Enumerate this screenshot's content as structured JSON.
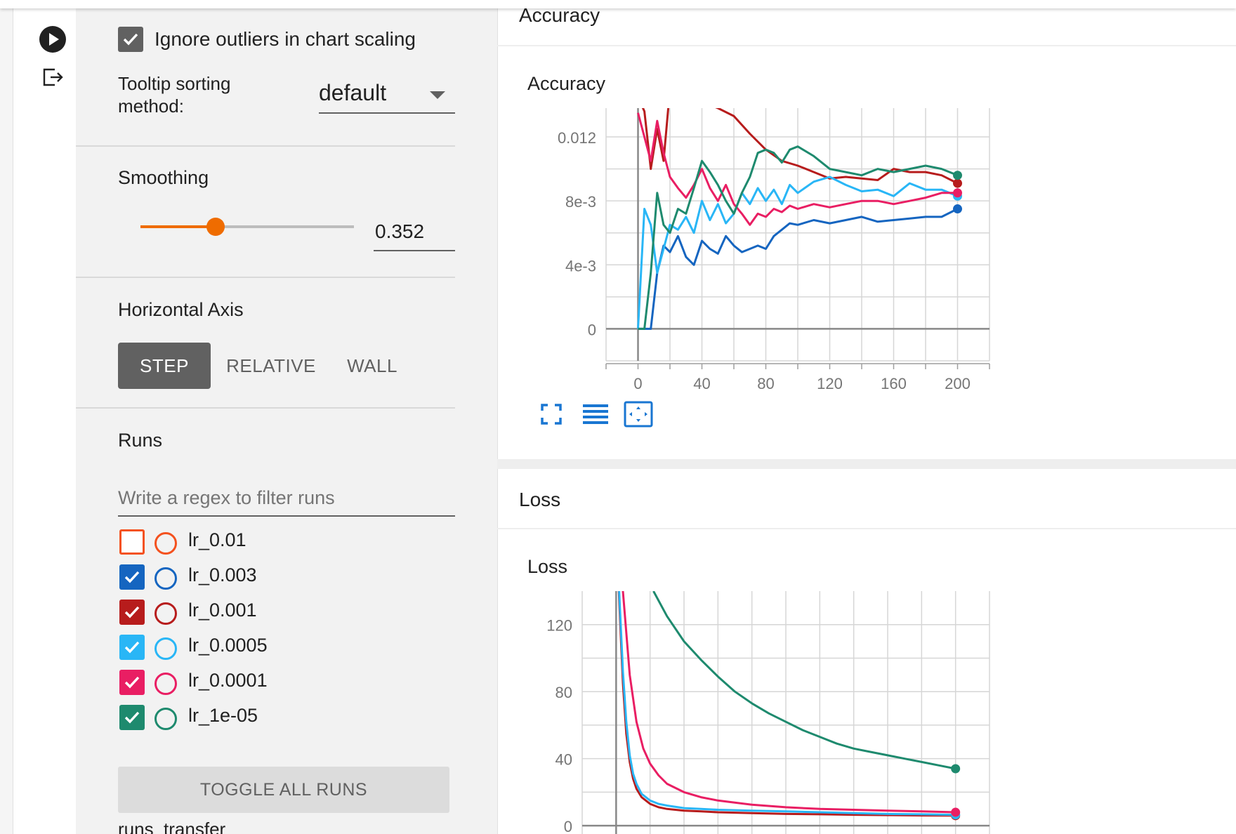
{
  "sidebar": {
    "ignore_outliers": {
      "label": "Ignore outliers in chart scaling",
      "checked": true
    },
    "tooltip_sort": {
      "label_line1": "Tooltip sorting",
      "label_line2": "method:",
      "value": "default"
    },
    "smoothing": {
      "label": "Smoothing",
      "value": "0.352",
      "fraction": 0.352
    },
    "horizontal_axis": {
      "label": "Horizontal Axis",
      "options": [
        "STEP",
        "RELATIVE",
        "WALL"
      ],
      "selected": "STEP"
    },
    "runs": {
      "label": "Runs",
      "filter_placeholder": "Write a regex to filter runs",
      "items": [
        {
          "name": "lr_0.01",
          "color": "#f4511e",
          "checked": false
        },
        {
          "name": "lr_0.003",
          "color": "#1565c0",
          "checked": true
        },
        {
          "name": "lr_0.001",
          "color": "#b71c1c",
          "checked": true
        },
        {
          "name": "lr_0.0005",
          "color": "#29b6f6",
          "checked": true
        },
        {
          "name": "lr_0.0001",
          "color": "#e91e63",
          "checked": true
        },
        {
          "name": "lr_1e-05",
          "color": "#1e8a6e",
          "checked": true
        }
      ],
      "toggle_all_label": "TOGGLE ALL RUNS",
      "footer": "runs_transfer"
    }
  },
  "rail": {
    "icons": [
      "play-icon",
      "logout-icon"
    ]
  },
  "main": {
    "accuracy_category": "Accuracy",
    "loss_category": "Loss"
  },
  "chart_data": [
    {
      "type": "line",
      "title": "Accuracy",
      "xlabel": "",
      "ylabel": "",
      "x_ticks": [
        "0",
        "40",
        "80",
        "120",
        "160",
        "200"
      ],
      "y_ticks": [
        "0",
        "4e-3",
        "8e-3",
        "0.012"
      ],
      "xlim": [
        -20,
        220
      ],
      "ylim": [
        -0.002,
        0.0138
      ],
      "grid": true,
      "series": [
        {
          "name": "lr_0.003",
          "color": "#1565c0",
          "x": [
            0,
            4,
            8,
            12,
            16,
            20,
            25,
            30,
            35,
            40,
            45,
            50,
            55,
            60,
            65,
            70,
            75,
            80,
            85,
            90,
            95,
            100,
            110,
            120,
            130,
            140,
            150,
            160,
            170,
            180,
            190,
            200
          ],
          "y": [
            0,
            0,
            0,
            0.0035,
            0.0052,
            0.0048,
            0.0058,
            0.0045,
            0.004,
            0.0055,
            0.005,
            0.0047,
            0.0058,
            0.0052,
            0.0048,
            0.005,
            0.0052,
            0.005,
            0.0058,
            0.0062,
            0.0066,
            0.0065,
            0.0068,
            0.0066,
            0.0068,
            0.007,
            0.0067,
            0.0068,
            0.0069,
            0.007,
            0.007,
            0.0075
          ]
        },
        {
          "name": "lr_0.001",
          "color": "#b71c1c",
          "x": [
            0,
            4,
            8,
            12,
            16,
            20,
            30,
            40,
            50,
            60,
            70,
            80,
            90,
            100,
            110,
            120,
            130,
            140,
            150,
            160,
            170,
            180,
            190,
            200
          ],
          "y": [
            0.0145,
            0.0136,
            0.01,
            0.0125,
            0.0105,
            0.015,
            0.0155,
            0.0142,
            0.0138,
            0.0133,
            0.0122,
            0.0112,
            0.0105,
            0.0102,
            0.0098,
            0.0094,
            0.0095,
            0.0094,
            0.0093,
            0.01,
            0.0098,
            0.0098,
            0.0096,
            0.0091
          ]
        },
        {
          "name": "lr_0.0005",
          "color": "#29b6f6",
          "x": [
            0,
            4,
            8,
            12,
            16,
            20,
            25,
            30,
            35,
            40,
            45,
            50,
            55,
            60,
            65,
            70,
            75,
            80,
            85,
            90,
            95,
            100,
            110,
            120,
            130,
            140,
            150,
            160,
            170,
            180,
            190,
            200
          ],
          "y": [
            0,
            0.0075,
            0.0065,
            0.0035,
            0.005,
            0.0065,
            0.0062,
            0.007,
            0.006,
            0.008,
            0.0068,
            0.0078,
            0.0066,
            0.0072,
            0.0085,
            0.0078,
            0.0088,
            0.008,
            0.0087,
            0.0078,
            0.009,
            0.0085,
            0.0092,
            0.0095,
            0.009,
            0.0086,
            0.0087,
            0.0083,
            0.0091,
            0.0087,
            0.0087,
            0.0083
          ]
        },
        {
          "name": "lr_0.0001",
          "color": "#e91e63",
          "x": [
            0,
            4,
            8,
            12,
            16,
            20,
            25,
            30,
            35,
            40,
            45,
            50,
            55,
            60,
            65,
            70,
            75,
            80,
            85,
            90,
            95,
            100,
            110,
            120,
            130,
            140,
            150,
            160,
            170,
            180,
            190,
            200
          ],
          "y": [
            0.0135,
            0.012,
            0.0105,
            0.013,
            0.011,
            0.0095,
            0.0088,
            0.0082,
            0.009,
            0.01,
            0.0088,
            0.008,
            0.009,
            0.0078,
            0.0072,
            0.0065,
            0.0072,
            0.007,
            0.0075,
            0.0073,
            0.0077,
            0.0075,
            0.0078,
            0.0076,
            0.0078,
            0.008,
            0.008,
            0.0078,
            0.008,
            0.0082,
            0.0085,
            0.0085
          ]
        },
        {
          "name": "lr_1e-05",
          "color": "#1e8a6e",
          "x": [
            0,
            4,
            8,
            12,
            16,
            20,
            25,
            30,
            35,
            40,
            45,
            50,
            55,
            60,
            65,
            70,
            75,
            80,
            85,
            90,
            95,
            100,
            110,
            120,
            130,
            140,
            150,
            160,
            170,
            180,
            190,
            200
          ],
          "y": [
            0,
            0,
            0.0035,
            0.0085,
            0.0065,
            0.006,
            0.0075,
            0.0072,
            0.0088,
            0.0105,
            0.0098,
            0.009,
            0.008,
            0.0072,
            0.0085,
            0.0095,
            0.011,
            0.0112,
            0.011,
            0.0104,
            0.0112,
            0.0114,
            0.0108,
            0.01,
            0.0098,
            0.0096,
            0.01,
            0.0098,
            0.01,
            0.0102,
            0.01,
            0.0096
          ]
        }
      ]
    },
    {
      "type": "line",
      "title": "Loss",
      "xlabel": "",
      "ylabel": "",
      "y_ticks": [
        "0",
        "40",
        "80",
        "120"
      ],
      "xlim": [
        -20,
        220
      ],
      "ylim": [
        -10,
        140
      ],
      "grid": true,
      "series": [
        {
          "name": "lr_0.001",
          "color": "#b71c1c",
          "x": [
            0,
            2,
            4,
            6,
            8,
            10,
            12,
            15,
            20,
            25,
            30,
            40,
            50,
            60,
            80,
            100,
            120,
            140,
            160,
            180,
            200
          ],
          "y": [
            180,
            130,
            85,
            55,
            38,
            28,
            22,
            17,
            13,
            11,
            10,
            9,
            8.5,
            8,
            7.5,
            7,
            6.8,
            6.5,
            6.3,
            6.1,
            6
          ]
        },
        {
          "name": "lr_0.0005",
          "color": "#29b6f6",
          "x": [
            0,
            2,
            4,
            6,
            8,
            10,
            12,
            15,
            20,
            25,
            30,
            40,
            50,
            60,
            80,
            100,
            120,
            140,
            160,
            180,
            200
          ],
          "y": [
            180,
            135,
            92,
            62,
            42,
            31,
            25,
            19,
            15,
            13,
            12,
            10.5,
            10,
            9.5,
            9,
            8.5,
            8,
            7.5,
            7,
            6.8,
            6.5
          ]
        },
        {
          "name": "lr_0.0001",
          "color": "#e91e63",
          "x": [
            0,
            4,
            8,
            12,
            16,
            20,
            25,
            30,
            40,
            50,
            60,
            80,
            100,
            120,
            140,
            160,
            180,
            200
          ],
          "y": [
            180,
            140,
            90,
            62,
            46,
            37,
            30,
            25,
            20,
            17,
            15,
            12.5,
            11,
            10,
            9.5,
            9,
            8.5,
            8
          ]
        },
        {
          "name": "lr_1e-05",
          "color": "#1e8a6e",
          "x": [
            22,
            30,
            40,
            50,
            60,
            70,
            80,
            90,
            100,
            110,
            120,
            130,
            140,
            150,
            160,
            170,
            180,
            190,
            200
          ],
          "y": [
            140,
            125,
            110,
            99,
            89,
            80,
            73,
            67,
            62,
            57,
            53,
            49,
            46,
            44,
            42,
            40,
            38,
            36,
            34
          ]
        }
      ]
    }
  ]
}
